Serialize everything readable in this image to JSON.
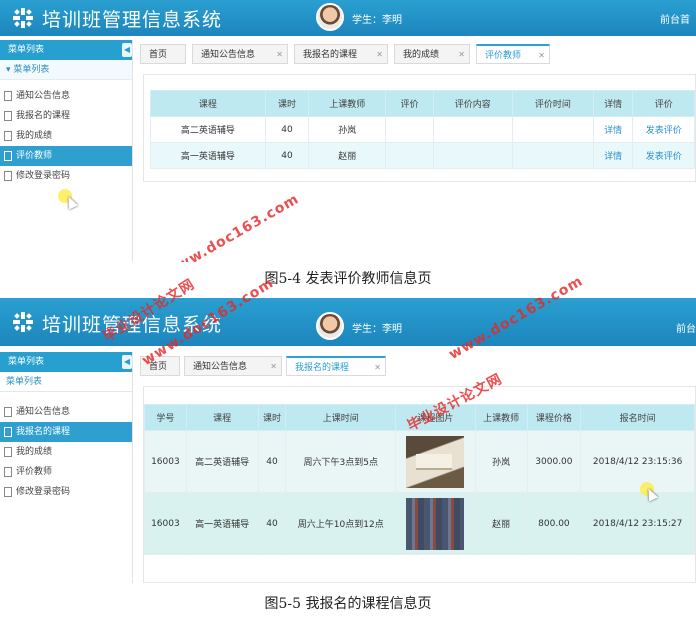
{
  "app": {
    "title": "培训班管理信息系统",
    "user": "学生：李明",
    "front_link": "前台首",
    "front_link_2": "前台"
  },
  "shot1": {
    "sidebar": {
      "header": "菜单列表",
      "section": "菜单列表",
      "items": [
        "通知公告信息",
        "我报名的课程",
        "我的成绩",
        "评价教师",
        "修改登录密码"
      ]
    },
    "tabs": [
      {
        "label": "首页"
      },
      {
        "label": "通知公告信息"
      },
      {
        "label": "我报名的课程"
      },
      {
        "label": "我的成绩"
      },
      {
        "label": "评价教师"
      }
    ],
    "table": {
      "headers": [
        "课程",
        "课时",
        "上课教师",
        "评价",
        "评价内容",
        "评价时间",
        "详情",
        "评价"
      ],
      "rows": [
        [
          "高二英语辅导",
          "40",
          "孙岚",
          "",
          "",
          "",
          "详情",
          "发表评价"
        ],
        [
          "高一英语辅导",
          "40",
          "赵丽",
          "",
          "",
          "",
          "详情",
          "发表评价"
        ]
      ]
    },
    "caption": "图5-4 发表评价教师信息页"
  },
  "shot2": {
    "sidebar": {
      "header": "菜单列表",
      "section": "菜单列表",
      "items": [
        "通知公告信息",
        "我报名的课程",
        "我的成绩",
        "评价教师",
        "修改登录密码"
      ]
    },
    "tabs": [
      {
        "label": "首页"
      },
      {
        "label": "通知公告信息"
      },
      {
        "label": "我报名的课程"
      }
    ],
    "table": {
      "headers": [
        "学号",
        "课程",
        "课时",
        "上课时间",
        "课程图片",
        "上课教师",
        "课程价格",
        "报名时间"
      ],
      "rows": [
        [
          "16003",
          "高二英语辅导",
          "40",
          "周六下午3点到5点",
          "",
          "孙岚",
          "3000.00",
          "2018/4/12 23:15:36"
        ],
        [
          "16003",
          "高一英语辅导",
          "40",
          "周六上午10点到12点",
          "",
          "赵丽",
          "800.00",
          "2018/4/12 23:15:27"
        ]
      ]
    },
    "caption": "图5-5 我报名的课程信息页"
  },
  "watermarks": {
    "site": "www.doc163.com",
    "name": "毕业设计论文网"
  },
  "colors": {
    "header_blue": "#1c86bd",
    "accent": "#29a3d3",
    "table_head": "#bfe9f0",
    "watermark": "#e62828"
  }
}
